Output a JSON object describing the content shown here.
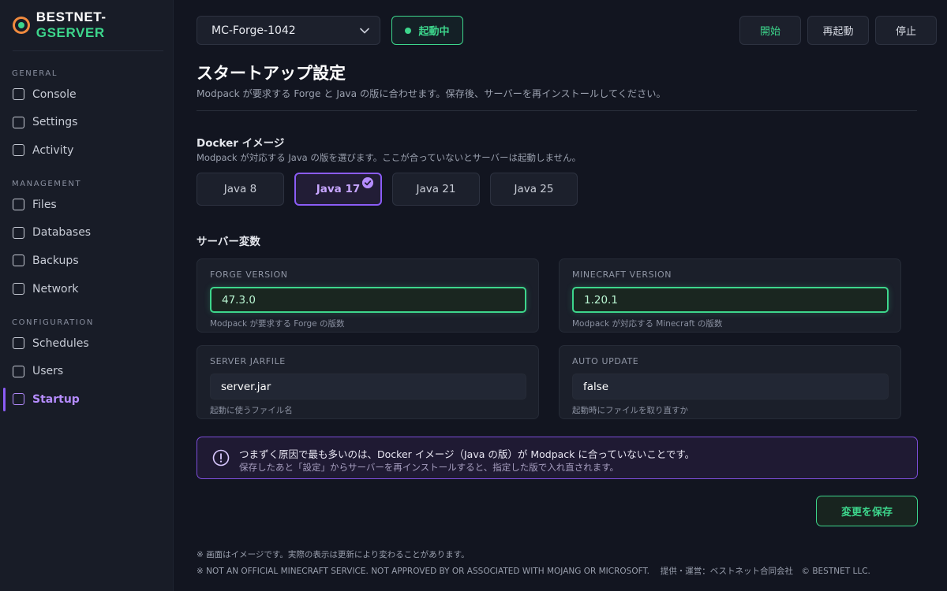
{
  "brand": {
    "prefix": "BESTNET-",
    "suffix": "GSERVER"
  },
  "sidebar": {
    "sections": [
      {
        "heading": "GENERAL",
        "items": [
          "Console",
          "Settings",
          "Activity"
        ]
      },
      {
        "heading": "MANAGEMENT",
        "items": [
          "Files",
          "Databases",
          "Backups",
          "Network"
        ]
      },
      {
        "heading": "CONFIGURATION",
        "items": [
          "Schedules",
          "Users",
          "Startup"
        ]
      }
    ],
    "active_item": "Startup"
  },
  "topbar": {
    "server_name": "MC-Forge-1042",
    "status": "起動中",
    "status_color": "#3dd68c",
    "buttons": {
      "start": "開始",
      "restart": "再起動",
      "stop": "停止"
    }
  },
  "header": {
    "title": "スタートアップ設定",
    "subtitle": "Modpack が要求する Forge と Java の版に合わせます。保存後、サーバーを再インストールしてください。"
  },
  "docker": {
    "title": "Docker イメージ",
    "description": "Modpack が対応する Java の版を選びます。ここが合っていないとサーバーは起動しません。",
    "options": [
      "Java 8",
      "Java 17",
      "Java 21",
      "Java 25"
    ],
    "selected": "Java 17"
  },
  "variables": {
    "title": "サーバー変数",
    "forge": {
      "label": "FORGE VERSION",
      "value": "47.3.0",
      "help": "Modpack が要求する Forge の版数"
    },
    "minecraft": {
      "label": "MINECRAFT VERSION",
      "value": "1.20.1",
      "help": "Modpack が対応する Minecraft の版数"
    },
    "jarfile": {
      "label": "SERVER JARFILE",
      "value": "server.jar",
      "help": "起動に使うファイル名"
    },
    "auto_update": {
      "label": "AUTO UPDATE",
      "value": "false",
      "help": "起動時にファイルを取り直すか"
    }
  },
  "notice": {
    "line1": "つまずく原因で最も多いのは、Docker イメージ（Java の版）が Modpack に合っていないことです。",
    "line2": "保存したあと「設定」からサーバーを再インストールすると、指定した版で入れ直されます。"
  },
  "save_label": "変更を保存",
  "footer": {
    "line1": "※ 画面はイメージです。実際の表示は更新により変わることがあります。",
    "line2": "※ NOT AN OFFICIAL MINECRAFT SERVICE. NOT APPROVED BY OR ASSOCIATED WITH MOJANG OR MICROSOFT.　 提供・運営：ベストネット合同会社　© BESTNET LLC."
  },
  "colors": {
    "accent_green": "#3dd68c",
    "accent_purple": "#8b5cf6",
    "background": "#121520",
    "sidebar": "#181c27"
  }
}
